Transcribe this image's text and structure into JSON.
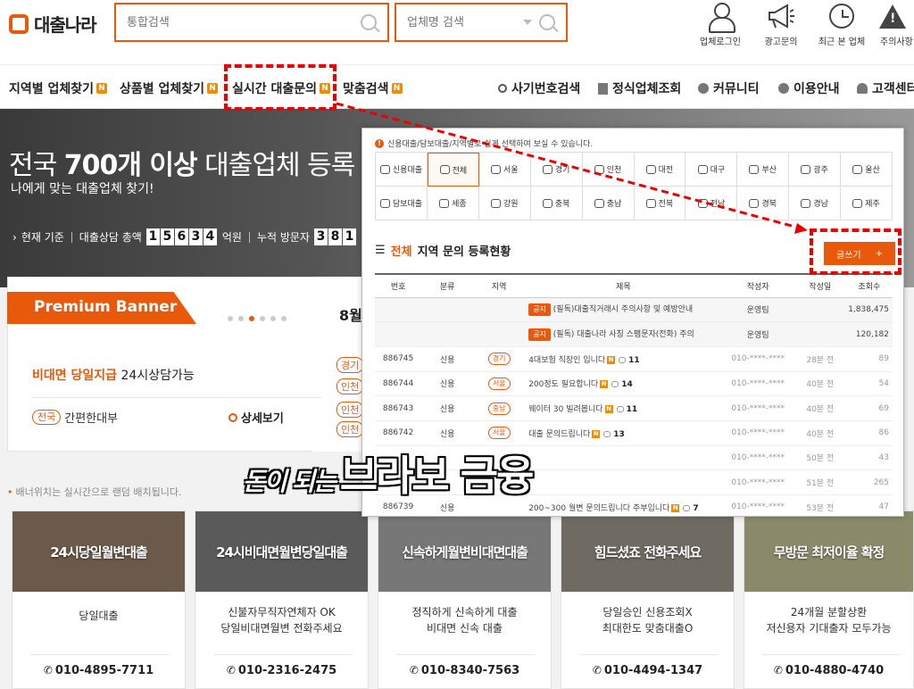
{
  "brand": {
    "logo_text": "대출나라",
    "accent": "#e8590c"
  },
  "search": {
    "main_placeholder": "통합검색",
    "company_placeholder": "업체명 검색"
  },
  "header_icons": [
    {
      "label": "업체로그인",
      "icon": "user-icon"
    },
    {
      "label": "광고문의",
      "icon": "megaphone-icon"
    },
    {
      "label": "최근 본 업체",
      "icon": "clock-icon"
    },
    {
      "label": "주의사항",
      "icon": "warning-icon"
    }
  ],
  "nav": {
    "left": [
      {
        "label": "지역별 업체찾기",
        "badge": "N"
      },
      {
        "label": "상품별 업체찾기",
        "badge": "N"
      },
      {
        "label": "실시간 대출문의",
        "badge": "N"
      },
      {
        "label": "맞춤검색",
        "badge": "N"
      }
    ],
    "right": [
      "사기번호검색",
      "정식업체조회",
      "커뮤니티",
      "이용안내",
      "고객센터"
    ]
  },
  "hero": {
    "title_pre": "전국",
    "title_bold": "700개 이상",
    "title_post": "대출업체 등록",
    "subtitle": "나에게 맞는 대출업체 찾기!",
    "stat_prefix": "현재 기준",
    "stat_label": "대출상담 총액",
    "stat_digits": [
      "1",
      "5",
      "6",
      "3",
      "4"
    ],
    "stat_unit": "억원",
    "visitor_label": "누적 방문자",
    "visitor_digits": [
      "3",
      "8",
      "1"
    ]
  },
  "premium": {
    "label": "Premium Banner",
    "line_highlight": "비대면 당일지급",
    "line_rest": "24시상담가능",
    "tag": "전국",
    "bottom_text": "간편한대부",
    "detail": "상세보기",
    "side_title": "8월",
    "side_tags": [
      "경기",
      "인천",
      "인천",
      "인천"
    ]
  },
  "notice": "배너위치는 실시간으로 랜덤 배치됩니다.",
  "cards": [
    {
      "title": "24시당일월변대출",
      "desc": [
        "당일대출"
      ],
      "phone": "010-4895-7711",
      "bg": "#6b5a4a"
    },
    {
      "title": "24시비대면월변당일대출",
      "desc": [
        "신불자무직자연체자 OK",
        "당일비대면월변 전화주세요"
      ],
      "phone": "010-2316-2475",
      "bg": "#5a5a5a"
    },
    {
      "title": "신속하게월변비대면대출",
      "desc": [
        "정직하게 신속하게 대출",
        "비대면 신속 대출"
      ],
      "phone": "010-8340-7563",
      "bg": "#777777"
    },
    {
      "title": "힘드셨죠 전화주세요",
      "desc": [
        "당일승인 신용조회X",
        "최대한도 맞춤대출O"
      ],
      "phone": "010-4494-1347",
      "bg": "#6f6a62"
    },
    {
      "title": "무방문 최저이율 확정",
      "desc": [
        "24개월 분할상환",
        "저신용자 기대출자 모두가능"
      ],
      "phone": "010-4880-4740",
      "bg": "#8a8a6a"
    }
  ],
  "overlay": {
    "note": "신용대출/담보대출/지역별로 쉽게 선택하여 보실 수 있습니다.",
    "regions_row1": [
      "신용대출",
      "전체",
      "서울",
      "경기",
      "인천",
      "대전",
      "대구",
      "부산",
      "광주",
      "울산"
    ],
    "regions_row2": [
      "담보대출",
      "세종",
      "강원",
      "충북",
      "충남",
      "전북",
      "전남",
      "경북",
      "경남",
      "제주"
    ],
    "heading_accent": "전체",
    "heading_rest": "지역 문의 등록현황",
    "write_button": "글쓰기",
    "columns": [
      "번호",
      "분류",
      "지역",
      "제목",
      "작성자",
      "작성일",
      "조회수"
    ],
    "notices": [
      {
        "tag": "공지",
        "title": "(필독)대출직거래시 주의사항 및 예방안내",
        "author": "운영팀",
        "views": "1,838,475"
      },
      {
        "tag": "공지",
        "title": "(필독) 대출나라 사칭 스팸문자(전화) 주의",
        "author": "운영팀",
        "views": "120,182"
      }
    ],
    "rows": [
      {
        "no": "886745",
        "cat": "신용",
        "region": "경기",
        "title": "4대보험 직장인 입니다",
        "comments": "11",
        "author": "010-****-****",
        "date": "28분 전",
        "views": "89"
      },
      {
        "no": "886744",
        "cat": "신용",
        "region": "서울",
        "title": "200정도 필요합니다",
        "comments": "14",
        "author": "010-****-****",
        "date": "40분 전",
        "views": "54"
      },
      {
        "no": "886743",
        "cat": "신용",
        "region": "충남",
        "title": "웨이터 30 빌려봅니다",
        "comments": "11",
        "author": "010-****-****",
        "date": "40분 전",
        "views": "69"
      },
      {
        "no": "886742",
        "cat": "신용",
        "region": "서울",
        "title": "대출 문의드립니다",
        "comments": "13",
        "author": "010-****-****",
        "date": "40분 전",
        "views": "86"
      },
      {
        "no": "",
        "cat": "",
        "region": "",
        "title": "",
        "comments": "",
        "author": "010-****-****",
        "date": "50분 전",
        "views": "43"
      },
      {
        "no": "",
        "cat": "",
        "region": "",
        "title": "",
        "comments": "",
        "author": "010-****-****",
        "date": "51분 전",
        "views": "265"
      },
      {
        "no": "886739",
        "cat": "신용",
        "region": "",
        "title": "200~300 월변 문의드립니다 주부입니다",
        "comments": "7",
        "author": "010-****-****",
        "date": "53분 전",
        "views": "47"
      }
    ]
  },
  "caption": {
    "small": "돈이 되는",
    "large": "브라보 금융"
  }
}
